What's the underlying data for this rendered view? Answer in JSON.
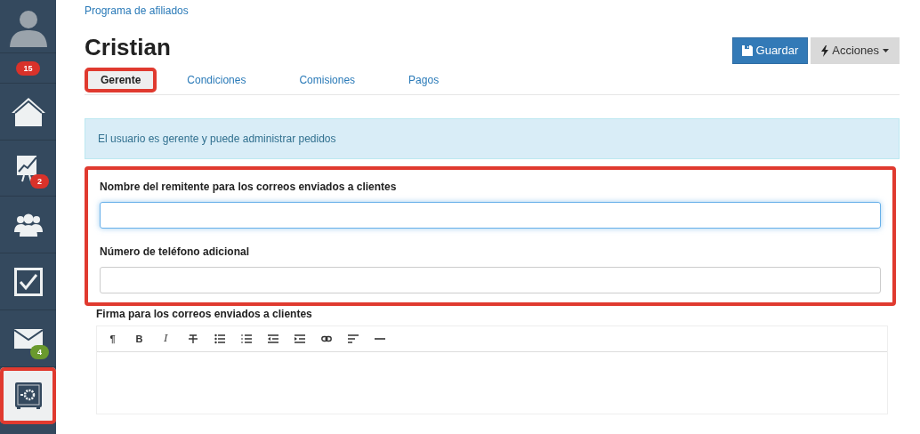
{
  "sidebar": {
    "items": [
      {
        "kind": "avatar",
        "selected": false,
        "highlighted": false
      },
      {
        "kind": "badge-only",
        "badge": "15",
        "color": "#d9322a",
        "selected": false,
        "highlighted": false
      },
      {
        "kind": "home",
        "selected": false,
        "highlighted": false
      },
      {
        "kind": "chart",
        "badge": "2",
        "color": "#d9322a",
        "selected": false,
        "highlighted": false
      },
      {
        "kind": "people",
        "selected": false,
        "highlighted": false
      },
      {
        "kind": "check",
        "selected": false,
        "highlighted": false
      },
      {
        "kind": "mail",
        "badge": "4",
        "color": "#6a9a2e",
        "selected": false,
        "highlighted": false
      },
      {
        "kind": "safe",
        "selected": true,
        "highlighted": true
      }
    ]
  },
  "breadcrumb": "Programa de afiliados",
  "title": "Cristian",
  "buttons": [
    {
      "kind": "primary",
      "label": "Guardar"
    },
    {
      "kind": "dropdown",
      "label": "Acciones"
    }
  ],
  "tabs": [
    {
      "label": "Gerente",
      "selected": true,
      "highlighted": true
    },
    {
      "label": "Condiciones",
      "selected": false,
      "highlighted": false
    },
    {
      "label": "Comisiones",
      "selected": false,
      "highlighted": false
    },
    {
      "label": "Pagos",
      "selected": false,
      "highlighted": false
    }
  ],
  "alert": "El usuario es gerente y puede administrar pedidos",
  "field_group": {
    "highlighted": true,
    "fields": [
      {
        "label": "Nombre del remitente para los correos enviados a clientes",
        "focused": true
      },
      {
        "label": "Número de teléfono adicional",
        "focused": false
      }
    ]
  },
  "signature": {
    "label": "Firma para los correos enviados a clientes",
    "tools": [
      {
        "kind": "text",
        "label": "¶"
      },
      {
        "kind": "text",
        "label": "B"
      },
      {
        "kind": "text",
        "label": "I"
      },
      {
        "kind": "strike"
      },
      {
        "kind": "bullets"
      },
      {
        "kind": "numbers"
      },
      {
        "kind": "outdent"
      },
      {
        "kind": "indent"
      },
      {
        "kind": "link"
      },
      {
        "kind": "align"
      },
      {
        "kind": "rule"
      }
    ]
  }
}
